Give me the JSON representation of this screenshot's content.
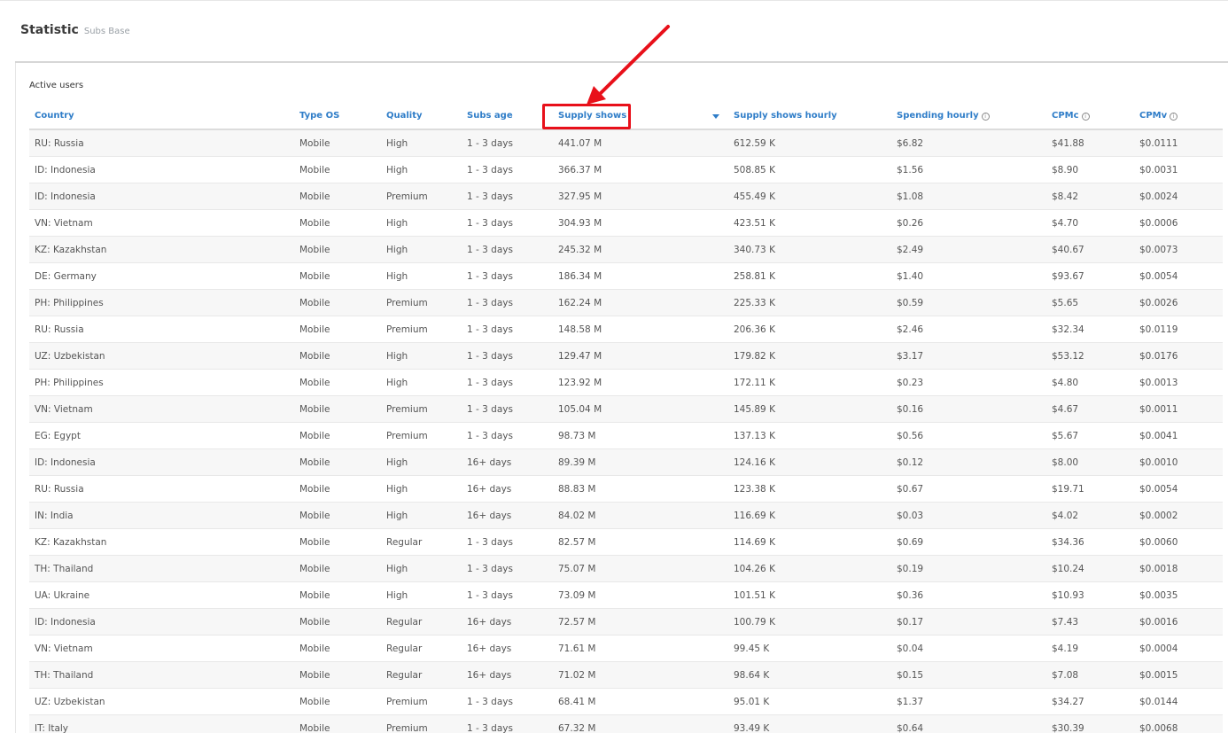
{
  "header": {
    "title": "Statistic",
    "subtitle": "Subs Base"
  },
  "section": {
    "title": "Active users"
  },
  "table": {
    "columns": [
      {
        "key": "country",
        "label": "Country",
        "info": false
      },
      {
        "key": "type_os",
        "label": "Type OS",
        "info": false
      },
      {
        "key": "quality",
        "label": "Quality",
        "info": false
      },
      {
        "key": "subs_age",
        "label": "Subs age",
        "info": false
      },
      {
        "key": "supply_shows",
        "label": "Supply shows",
        "info": false,
        "sorted": "desc"
      },
      {
        "key": "supply_shows_hourly",
        "label": "Supply shows hourly",
        "info": false
      },
      {
        "key": "spending_hourly",
        "label": "Spending hourly",
        "info": true
      },
      {
        "key": "cpmc",
        "label": "CPMc",
        "info": true
      },
      {
        "key": "cpmv",
        "label": "CPMv",
        "info": true
      }
    ],
    "info_glyph": "i",
    "rows": [
      [
        "RU: Russia",
        "Mobile",
        "High",
        "1 - 3 days",
        "441.07 M",
        "612.59 K",
        "$6.82",
        "$41.88",
        "$0.0111"
      ],
      [
        "ID: Indonesia",
        "Mobile",
        "High",
        "1 - 3 days",
        "366.37 M",
        "508.85 K",
        "$1.56",
        "$8.90",
        "$0.0031"
      ],
      [
        "ID: Indonesia",
        "Mobile",
        "Premium",
        "1 - 3 days",
        "327.95 M",
        "455.49 K",
        "$1.08",
        "$8.42",
        "$0.0024"
      ],
      [
        "VN: Vietnam",
        "Mobile",
        "High",
        "1 - 3 days",
        "304.93 M",
        "423.51 K",
        "$0.26",
        "$4.70",
        "$0.0006"
      ],
      [
        "KZ: Kazakhstan",
        "Mobile",
        "High",
        "1 - 3 days",
        "245.32 M",
        "340.73 K",
        "$2.49",
        "$40.67",
        "$0.0073"
      ],
      [
        "DE: Germany",
        "Mobile",
        "High",
        "1 - 3 days",
        "186.34 M",
        "258.81 K",
        "$1.40",
        "$93.67",
        "$0.0054"
      ],
      [
        "PH: Philippines",
        "Mobile",
        "Premium",
        "1 - 3 days",
        "162.24 M",
        "225.33 K",
        "$0.59",
        "$5.65",
        "$0.0026"
      ],
      [
        "RU: Russia",
        "Mobile",
        "Premium",
        "1 - 3 days",
        "148.58 M",
        "206.36 K",
        "$2.46",
        "$32.34",
        "$0.0119"
      ],
      [
        "UZ: Uzbekistan",
        "Mobile",
        "High",
        "1 - 3 days",
        "129.47 M",
        "179.82 K",
        "$3.17",
        "$53.12",
        "$0.0176"
      ],
      [
        "PH: Philippines",
        "Mobile",
        "High",
        "1 - 3 days",
        "123.92 M",
        "172.11 K",
        "$0.23",
        "$4.80",
        "$0.0013"
      ],
      [
        "VN: Vietnam",
        "Mobile",
        "Premium",
        "1 - 3 days",
        "105.04 M",
        "145.89 K",
        "$0.16",
        "$4.67",
        "$0.0011"
      ],
      [
        "EG: Egypt",
        "Mobile",
        "Premium",
        "1 - 3 days",
        "98.73 M",
        "137.13 K",
        "$0.56",
        "$5.67",
        "$0.0041"
      ],
      [
        "ID: Indonesia",
        "Mobile",
        "High",
        "16+ days",
        "89.39 M",
        "124.16 K",
        "$0.12",
        "$8.00",
        "$0.0010"
      ],
      [
        "RU: Russia",
        "Mobile",
        "High",
        "16+ days",
        "88.83 M",
        "123.38 K",
        "$0.67",
        "$19.71",
        "$0.0054"
      ],
      [
        "IN: India",
        "Mobile",
        "High",
        "16+ days",
        "84.02 M",
        "116.69 K",
        "$0.03",
        "$4.02",
        "$0.0002"
      ],
      [
        "KZ: Kazakhstan",
        "Mobile",
        "Regular",
        "1 - 3 days",
        "82.57 M",
        "114.69 K",
        "$0.69",
        "$34.36",
        "$0.0060"
      ],
      [
        "TH: Thailand",
        "Mobile",
        "High",
        "1 - 3 days",
        "75.07 M",
        "104.26 K",
        "$0.19",
        "$10.24",
        "$0.0018"
      ],
      [
        "UA: Ukraine",
        "Mobile",
        "High",
        "1 - 3 days",
        "73.09 M",
        "101.51 K",
        "$0.36",
        "$10.93",
        "$0.0035"
      ],
      [
        "ID: Indonesia",
        "Mobile",
        "Regular",
        "16+ days",
        "72.57 M",
        "100.79 K",
        "$0.17",
        "$7.43",
        "$0.0016"
      ],
      [
        "VN: Vietnam",
        "Mobile",
        "Regular",
        "16+ days",
        "71.61 M",
        "99.45 K",
        "$0.04",
        "$4.19",
        "$0.0004"
      ],
      [
        "TH: Thailand",
        "Mobile",
        "Regular",
        "16+ days",
        "71.02 M",
        "98.64 K",
        "$0.15",
        "$7.08",
        "$0.0015"
      ],
      [
        "UZ: Uzbekistan",
        "Mobile",
        "Premium",
        "1 - 3 days",
        "68.41 M",
        "95.01 K",
        "$1.37",
        "$34.27",
        "$0.0144"
      ],
      [
        "IT: Italy",
        "Mobile",
        "Premium",
        "1 - 3 days",
        "67.32 M",
        "93.49 K",
        "$0.64",
        "$30.39",
        "$0.0068"
      ]
    ]
  },
  "colors": {
    "accent": "#2f7dc8",
    "annotation": "#e8101a",
    "row_alt": "#f7f7f7",
    "text": "#555555"
  }
}
